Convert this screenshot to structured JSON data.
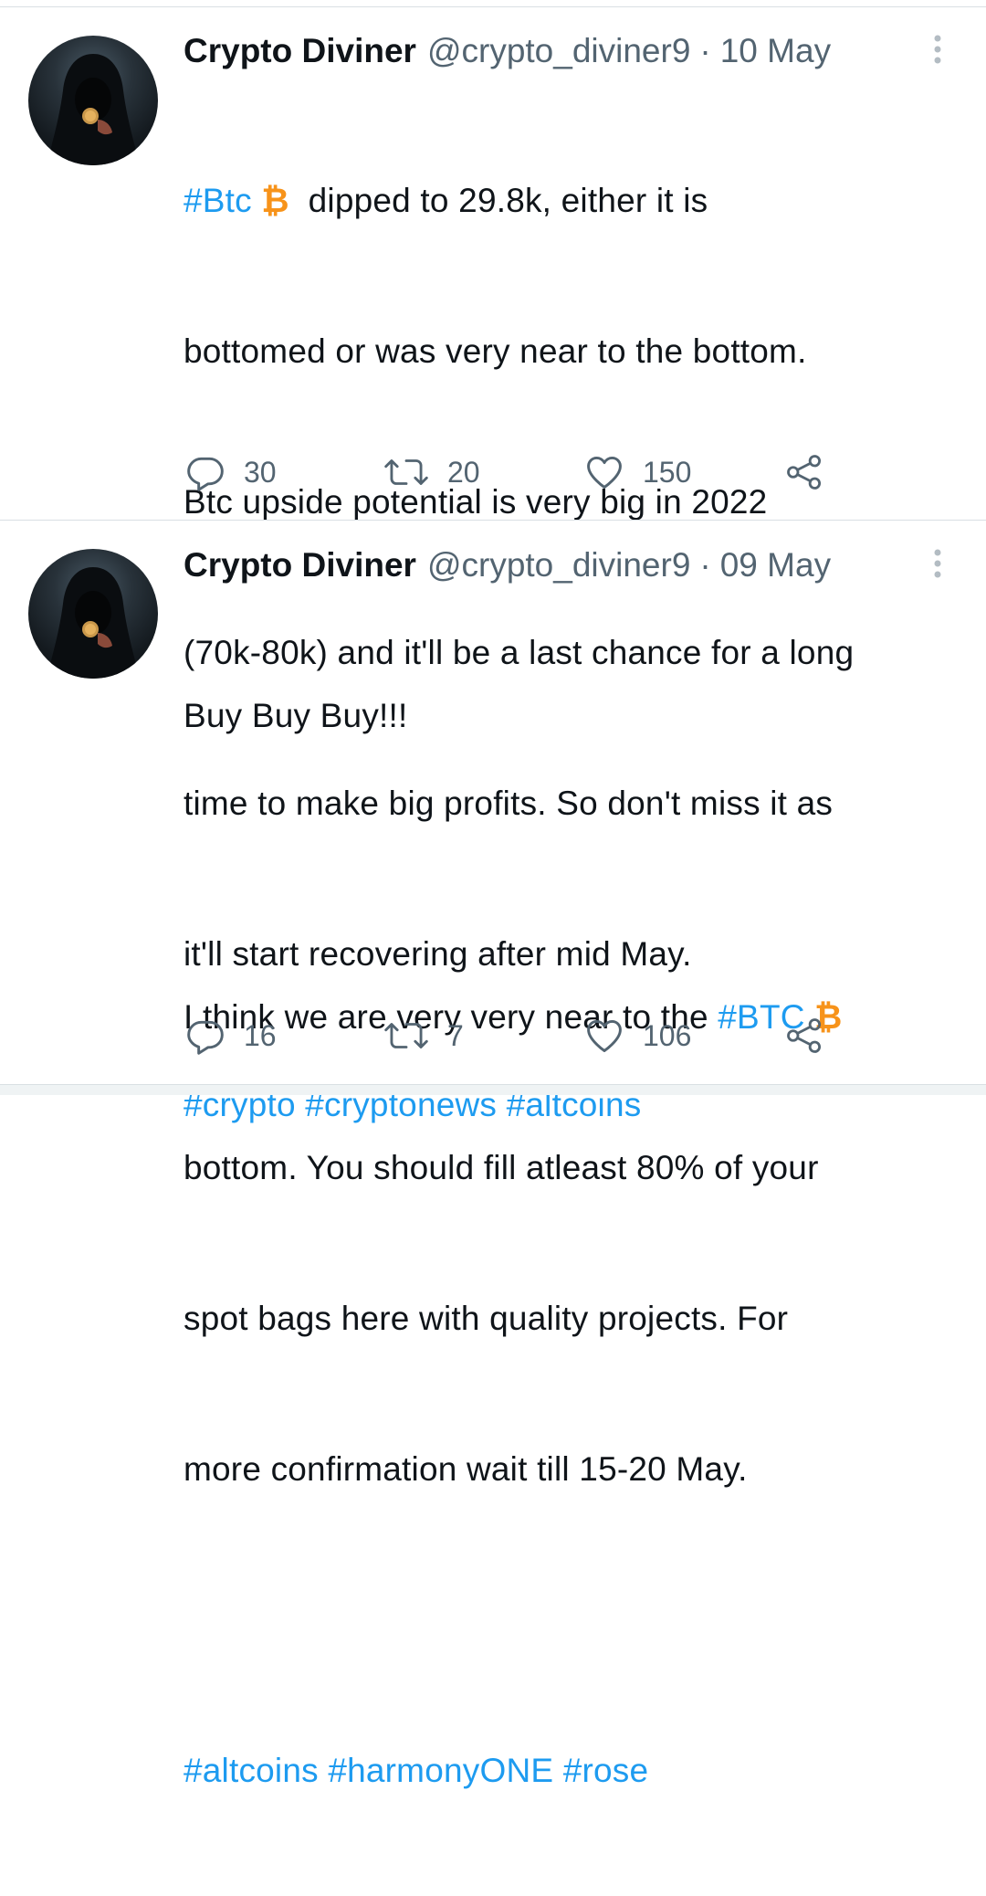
{
  "tweets": [
    {
      "name": "Crypto Diviner",
      "handle": "@crypto_diviner9",
      "separator": "·",
      "date": "10 May",
      "text": {
        "tag_btc": "#Btc",
        "btc_symbol": "₿",
        "line1_rest": "  dipped to 29.8k, either it is",
        "line2": "bottomed or was very near to the bottom.",
        "line3": "Btc upside potential is very big in 2022",
        "line4": "(70k-80k) and it'll be a last chance for a long",
        "line5": "time to make big profits. So don't miss it as",
        "line6": "it'll start recovering after mid May.",
        "hashtags": [
          "#crypto",
          "#cryptonews",
          "#altcoins"
        ]
      },
      "actions": {
        "replies": "30",
        "retweets": "20",
        "likes": "150"
      }
    },
    {
      "name": "Crypto Diviner",
      "handle": "@crypto_diviner9",
      "separator": "·",
      "date": "09 May",
      "text": {
        "line1": "Buy Buy Buy!!!",
        "line2_start": "I think we are very very near to the ",
        "tag_btc": "#BTC",
        "btc_symbol": "₿",
        "line3": "bottom. You should fill atleast 80% of your",
        "line4": "spot bags here with quality projects. For",
        "line5": "more confirmation wait till 15-20 May.",
        "hashtags": [
          "#altcoins",
          "#harmonyONE",
          "#rose"
        ]
      },
      "actions": {
        "replies": "16",
        "retweets": "7",
        "likes": "106"
      }
    }
  ],
  "colors": {
    "text": "#0f1419",
    "secondary": "#536471",
    "link": "#1d9bf0",
    "bitcoin": "#f7931a",
    "divider": "#d9dfe3"
  },
  "icons": [
    "reply-icon",
    "retweet-icon",
    "like-icon",
    "share-icon",
    "more-icon",
    "bitcoin-icon"
  ]
}
